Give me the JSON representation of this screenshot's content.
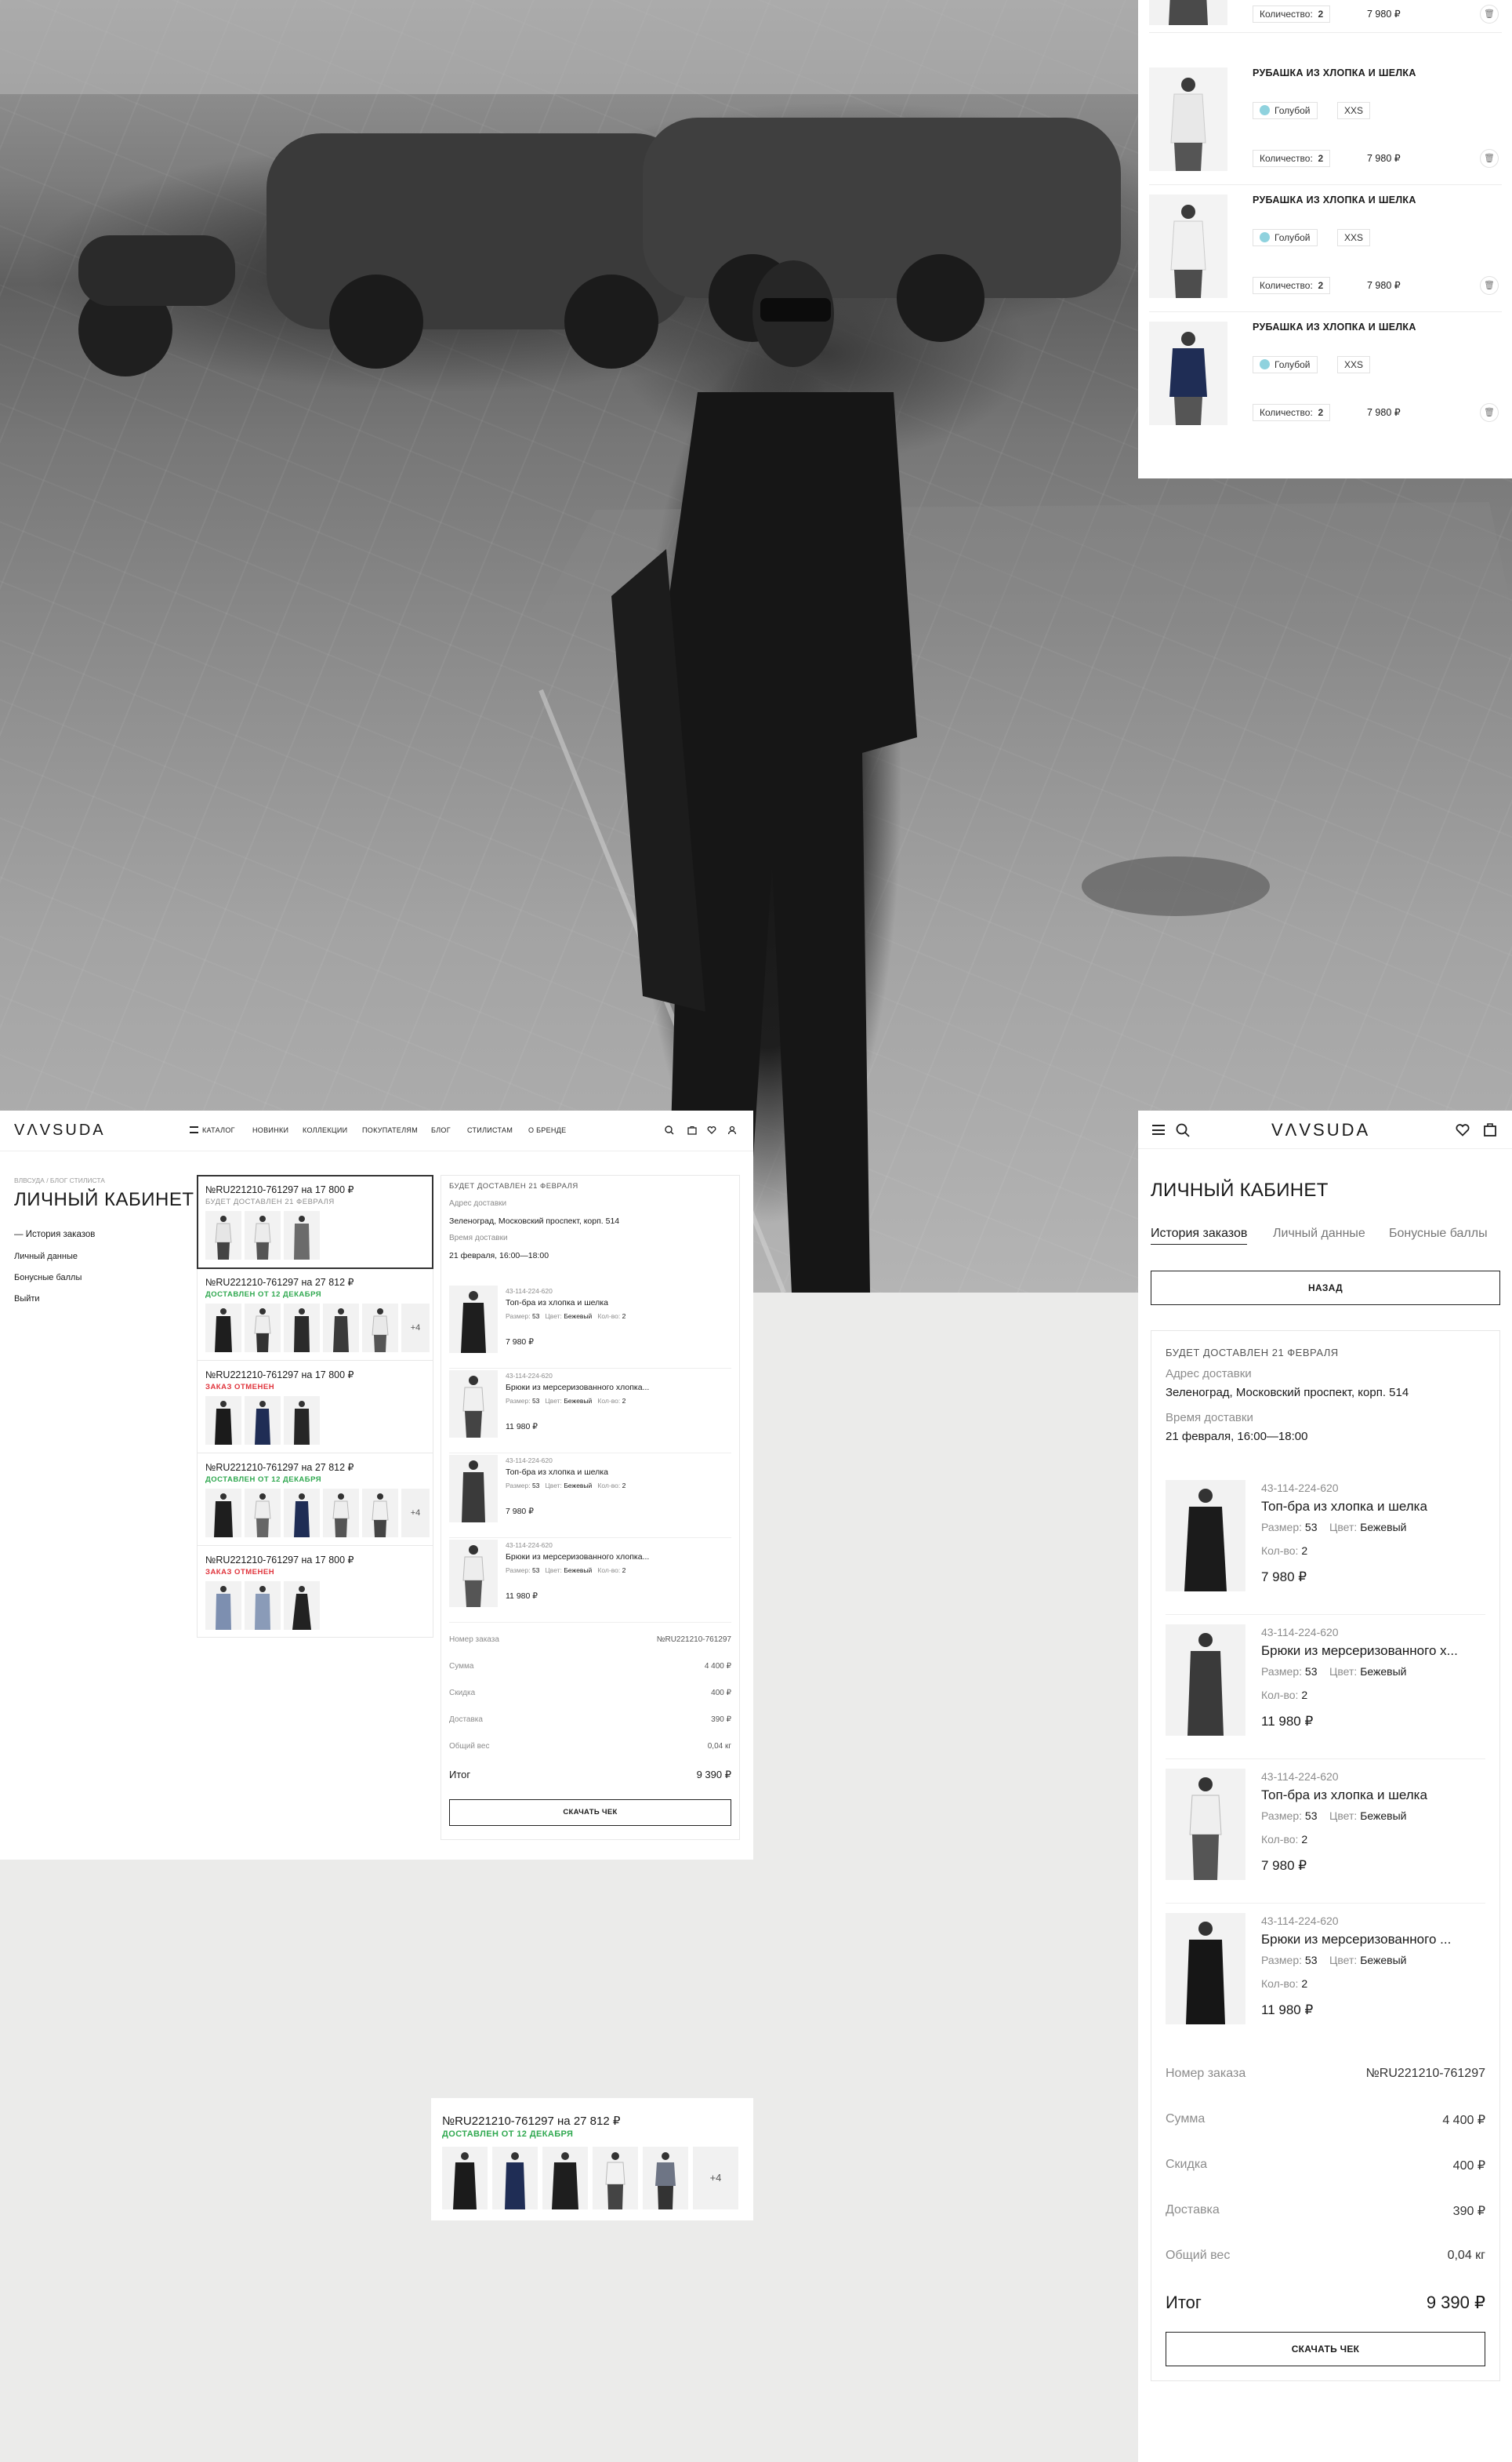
{
  "cart": {
    "quantity_label": "Количество:",
    "items": [
      {
        "name": "",
        "color": "",
        "size": "",
        "qty": "2",
        "price": "7 980 ₽"
      },
      {
        "name": "РУБАШКА ИЗ ХЛОПКА И ШЕЛКА",
        "color": "Голубой",
        "size": "XXS",
        "qty": "2",
        "price": "7 980 ₽"
      },
      {
        "name": "РУБАШКА ИЗ ХЛОПКА И ШЕЛКА",
        "color": "Голубой",
        "size": "XXS",
        "qty": "2",
        "price": "7 980 ₽"
      },
      {
        "name": "РУБАШКА ИЗ ХЛОПКА И ШЕЛКА",
        "color": "Голубой",
        "size": "XXS",
        "qty": "2",
        "price": "7 980 ₽"
      }
    ]
  },
  "brand": {
    "logo": "VΛVSUDA"
  },
  "nav": {
    "items": [
      "КАТАЛОГ",
      "НОВИНКИ",
      "КОЛЛЕКЦИИ",
      "ПОКУПАТЕЛЯМ",
      "БЛОГ",
      "СТИЛИСТАМ",
      "О БРЕНДЕ"
    ]
  },
  "breadcrumb": "ВЛВСУДА  /  БЛОГ СТИЛИСТА",
  "account": {
    "title": "ЛИЧНЫЙ КАБИНЕТ",
    "menu": [
      "История заказов",
      "Личный данные",
      "Бонусные баллы",
      "Выйти"
    ],
    "mobile_tabs": [
      "История заказов",
      "Личный данные",
      "Бонусные баллы"
    ],
    "back_label": "НАЗАД"
  },
  "orders": [
    {
      "number": "№RU221210-761297 на 17 800 ₽",
      "status": "БУДЕТ ДОСТАВЛЕН 21 ФЕВРАЛЯ",
      "status_color": "#8c8c8c",
      "extra": ""
    },
    {
      "number": "№RU221210-761297 на 27 812 ₽",
      "status": "ДОСТАВЛЕН ОТ 12 ДЕКАБРЯ",
      "status_color": "#2fa84f",
      "extra": "+4"
    },
    {
      "number": "№RU221210-761297 на 17 800 ₽",
      "status": "ЗАКАЗ ОТМЕНЕН",
      "status_color": "#e0333b",
      "extra": ""
    },
    {
      "number": "№RU221210-761297 на 27 812 ₽",
      "status": "ДОСТАВЛЕН ОТ 12 ДЕКАБРЯ",
      "status_color": "#2fa84f",
      "extra": "+4"
    },
    {
      "number": "№RU221210-761297 на 17 800 ₽",
      "status": "ЗАКАЗ ОТМЕНЕН",
      "status_color": "#e0333b",
      "extra": ""
    }
  ],
  "detail": {
    "delivery_status": "БУДЕТ ДОСТАВЛЕН 21 ФЕВРАЛЯ",
    "address_label": "Адрес доставки",
    "address": "Зеленоград, Московский проспект, корп. 514",
    "time_label": "Время доставки",
    "time": "21 февраля, 16:00—18:00",
    "size_label": "Размер:",
    "color_label": "Цвет:",
    "qty_label": "Кол-во:",
    "products": [
      {
        "sku": "43-114-224-620",
        "name": "Топ-бра из хлопка и шелка",
        "size": "53",
        "color": "Бежевый",
        "qty": "2",
        "price": "7 980 ₽"
      },
      {
        "sku": "43-114-224-620",
        "name": "Брюки из мерсеризованного хлопка...",
        "size": "53",
        "color": "Бежевый",
        "qty": "2",
        "price": "11 980 ₽"
      },
      {
        "sku": "43-114-224-620",
        "name": "Топ-бра из хлопка и шелка",
        "size": "53",
        "color": "Бежевый",
        "qty": "2",
        "price": "7 980 ₽"
      },
      {
        "sku": "43-114-224-620",
        "name": "Брюки из мерсеризованного хлопка...",
        "size": "53",
        "color": "Бежевый",
        "qty": "2",
        "price": "11 980 ₽"
      }
    ],
    "mobile_names": [
      "Топ-бра из хлопка и шелка",
      "Брюки из мерсеризованного х...",
      "Топ-бра из хлопка и шелка",
      "Брюки из мерсеризованного ..."
    ],
    "mobile_qty_label": "Кол-во:",
    "summary": {
      "order_label": "Номер заказа",
      "order_value": "№RU221210-761297",
      "sum_label": "Сумма",
      "sum_value": "4 400 ₽",
      "discount_label": "Скидка",
      "discount_value": "400 ₽",
      "delivery_label": "Доставка",
      "delivery_value": "390 ₽",
      "weight_label": "Общий вес",
      "weight_value": "0,04 кг",
      "total_label": "Итог",
      "total_value": "9 390 ₽"
    },
    "receipt_label": "СКАЧАТЬ ЧЕК"
  },
  "snippet": {
    "number": "№RU221210-761297 на 27 812 ₽",
    "status": "ДОСТАВЛЕН ОТ 12 ДЕКАБРЯ",
    "extra": "+4"
  },
  "colors": {
    "delivered": "#2fa84f",
    "cancelled": "#e0333b",
    "swatch_blue": "#8fd2de"
  }
}
